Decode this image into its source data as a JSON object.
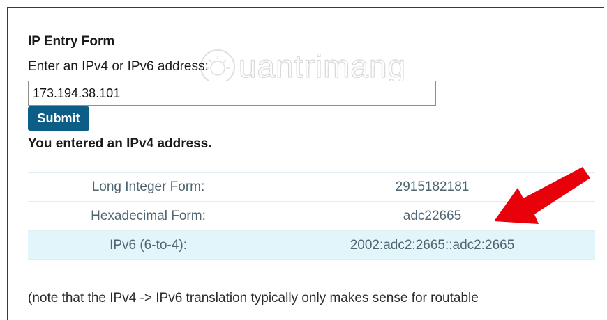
{
  "form": {
    "title": "IP Entry Form",
    "prompt": "Enter an IPv4 or IPv6 address:",
    "input_value": "173.194.38.101",
    "submit_label": "Submit",
    "result_message": "You entered an IPv4 address."
  },
  "conversions": [
    {
      "label": "Long Integer Form:",
      "value": "2915182181"
    },
    {
      "label": "Hexadecimal Form:",
      "value": "adc22665"
    },
    {
      "label": "IPv6 (6-to-4):",
      "value": "2002:adc2:2665::adc2:2665"
    }
  ],
  "note": "(note that the IPv4 -> IPv6 translation typically only makes sense for routable",
  "watermark": {
    "text": "uantrimang",
    "icon": "sun-icon"
  },
  "arrow": {
    "icon": "red-arrow-icon",
    "color": "#e8000b",
    "points_to": "conversions.1.value"
  },
  "colors": {
    "button": "#0c5e86",
    "highlight_row": "#e1f5fb",
    "table_text": "#4f6672"
  }
}
